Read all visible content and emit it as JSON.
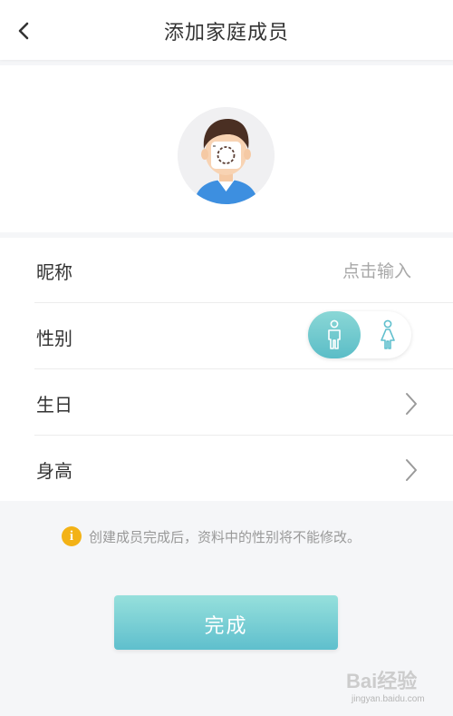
{
  "header": {
    "title": "添加家庭成员",
    "back_icon": "chevron-left-icon"
  },
  "avatar": {
    "icon": "camera-icon"
  },
  "form": {
    "nickname": {
      "label": "昵称",
      "placeholder": "点击输入"
    },
    "gender": {
      "label": "性别",
      "selected": "male",
      "options": [
        "male",
        "female"
      ]
    },
    "birthday": {
      "label": "生日"
    },
    "height": {
      "label": "身高"
    }
  },
  "notice": {
    "icon": "info-icon",
    "icon_glyph": "i",
    "text": "创建成员完成后，资料中的性别将不能修改。"
  },
  "done_button": {
    "label": "完成"
  },
  "watermark": {
    "logo": "Bai经验",
    "url": "jingyan.baidu.com"
  },
  "colors": {
    "accent": "#5fbfcd",
    "accent_light": "#96e0dc",
    "notice_icon": "#f3b216",
    "background": "#f5f6f8"
  }
}
